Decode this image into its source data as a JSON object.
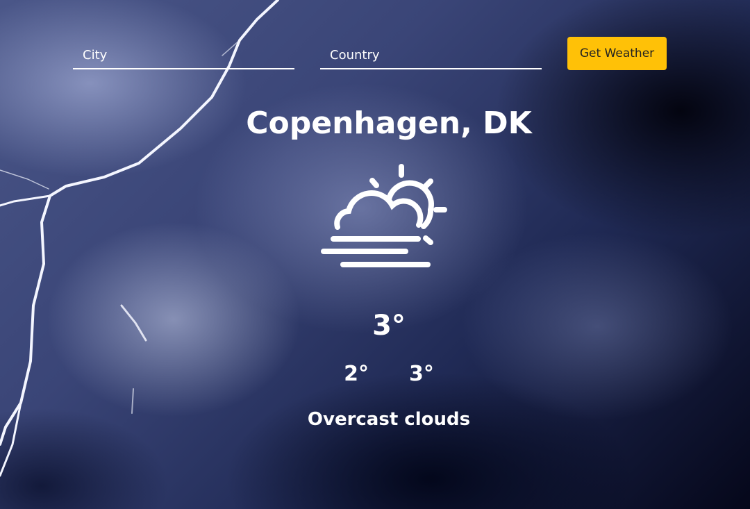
{
  "search": {
    "city_placeholder": "City",
    "country_placeholder": "Country",
    "submit_label": "Get Weather",
    "accent_color": "#ffc107"
  },
  "weather": {
    "location": "Copenhagen, DK",
    "icon": "partly-cloudy-fog-icon",
    "temperature": "3°",
    "temp_min": "2°",
    "temp_max": "3°",
    "description": "Overcast clouds"
  },
  "background": {
    "scene": "stormy-sky-with-lightning"
  }
}
